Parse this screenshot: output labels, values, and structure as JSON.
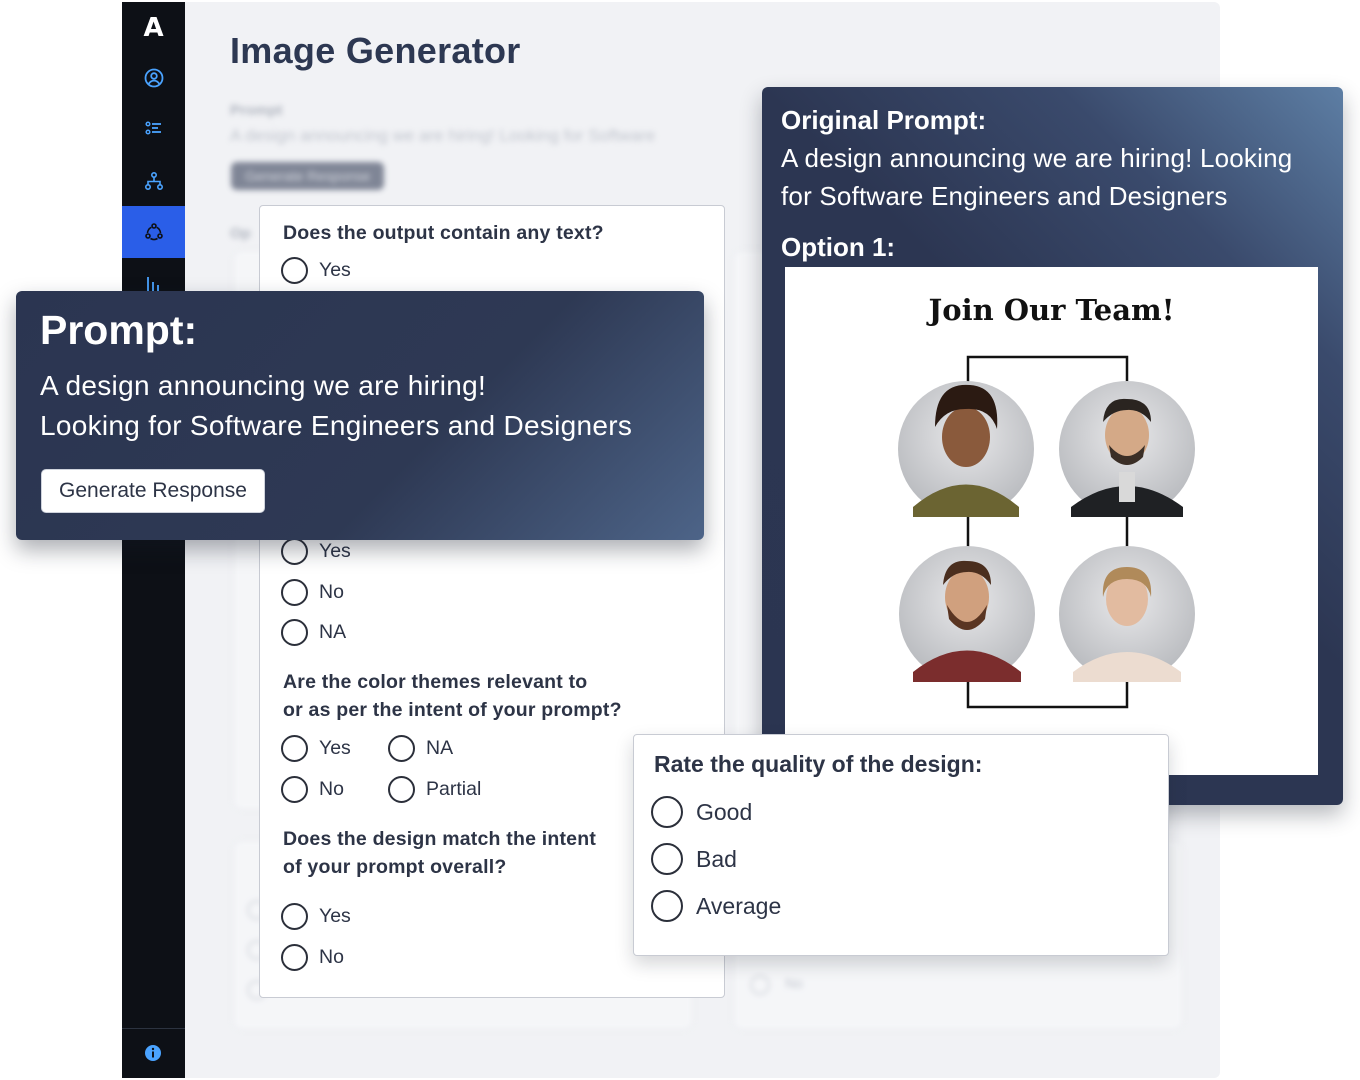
{
  "app": {
    "logo": "A",
    "page_title": "Image Generator",
    "sidebar": {
      "items": [
        {
          "icon": "user-circle-icon",
          "active": false
        },
        {
          "icon": "list-icon",
          "active": false
        },
        {
          "icon": "hierarchy-icon",
          "active": false
        },
        {
          "icon": "cycle-icon",
          "active": true
        },
        {
          "icon": "bar-chart-icon",
          "active": false
        }
      ],
      "footer_icon": "info-icon"
    },
    "accent_color": "#2a5ee8"
  },
  "questions": [
    {
      "text": "Does the output contain any text?",
      "options": [
        "Yes"
      ]
    },
    {
      "text": "",
      "options": [
        "Yes",
        "No",
        "NA"
      ]
    },
    {
      "text_line1": "Are the color themes relevant to",
      "text_line2": "or as per the intent of your prompt?",
      "options": [
        "Yes",
        "NA",
        "No",
        "Partial"
      ]
    },
    {
      "text_line1": "Does the design match the intent",
      "text_line2": "of your prompt overall?",
      "options": [
        "Yes",
        "No"
      ]
    }
  ],
  "prompt_panel": {
    "title": "Prompt:",
    "line1": "A design announcing we are hiring!",
    "line2": "Looking for Software Engineers and Designers",
    "button": "Generate Response"
  },
  "original_panel": {
    "title": "Original Prompt:",
    "line1": "A design announcing we are hiring! Looking",
    "line2": "for Software Engineers and Designers",
    "option_label": "Option 1:",
    "design_title": "Join Our Team!"
  },
  "rating": {
    "question": "Rate the quality of the design:",
    "options": [
      "Good",
      "Bad",
      "Average"
    ]
  }
}
